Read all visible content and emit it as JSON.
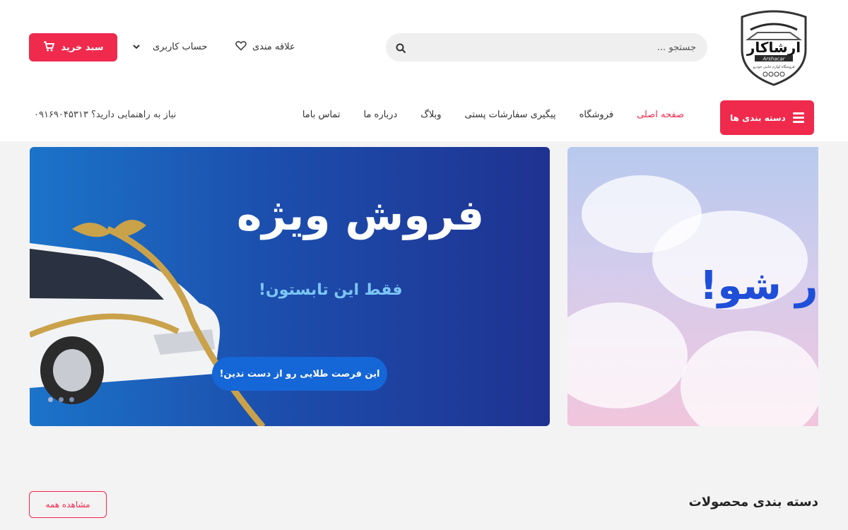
{
  "logo": {
    "brand_fa": "ارشاکار",
    "brand_en": "Arshacar",
    "tagline": "فروشگاه لوازم جانبی خودرو"
  },
  "search": {
    "placeholder": "جستجو ..."
  },
  "header": {
    "wishlist_label": "علاقه مندی",
    "account_label": "حساب کاربری",
    "cart_label": "سبد خرید"
  },
  "nav": {
    "categories_button": "دسته بندی ها",
    "items": [
      {
        "label": "صفحه اصلی"
      },
      {
        "label": "فروشگاه"
      },
      {
        "label": "پیگیری سفارشات پستی"
      },
      {
        "label": "وبلاگ"
      },
      {
        "label": "درباره ما"
      },
      {
        "label": "تماس باما"
      }
    ],
    "help_text": "نیاز به راهنمایی دارید؟ ۰۹۱۶۹۰۴۵۳۱۳"
  },
  "slider": {
    "main": {
      "title": "فروش ویژه",
      "subtitle": "فقط این تابستون!",
      "cta": "این فرصت طلایی رو از دست ندین!"
    },
    "second": {
      "title": "وار شو!"
    },
    "active_index": 3,
    "dot_count": 3
  },
  "categories_section": {
    "title": "دسته بندی محصولات",
    "see_all": "مشاهده همه"
  },
  "colors": {
    "accent": "#ef2a4d",
    "banner_blue": "#1f3291"
  }
}
